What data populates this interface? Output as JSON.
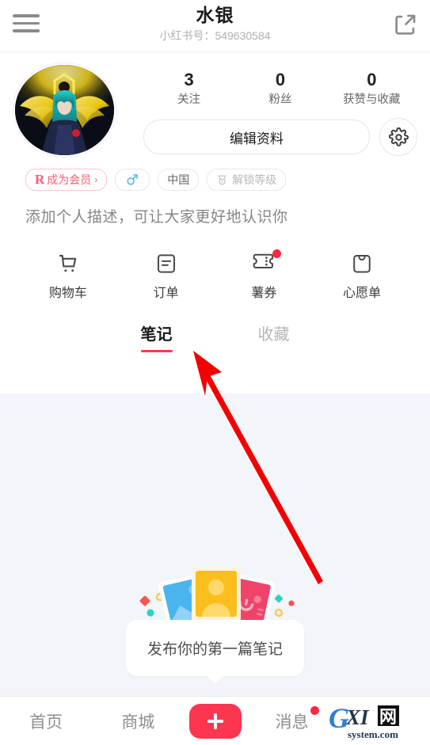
{
  "header": {
    "title": "水银",
    "subtitle": "小红书号：549630584",
    "menu_icon": "hamburger-icon",
    "share_icon": "share-icon"
  },
  "profile": {
    "avatar_alt": "anime-winged-character-avatar",
    "stats": [
      {
        "value": "3",
        "label": "关注"
      },
      {
        "value": "0",
        "label": "粉丝"
      },
      {
        "value": "0",
        "label": "获赞与收藏"
      }
    ],
    "edit_label": "编辑资料",
    "settings_icon": "gear-icon",
    "bio_placeholder": "添加个人描述，可让大家更好地认识你",
    "tags": [
      {
        "id": "member",
        "prefix": "R",
        "label": "成为会员",
        "chevron": "›"
      },
      {
        "id": "gender",
        "label": "♂"
      },
      {
        "id": "region",
        "label": "中国"
      },
      {
        "id": "level",
        "label": "解锁等级"
      }
    ]
  },
  "quick_actions": [
    {
      "label": "购物车",
      "icon": "cart-icon",
      "badge": false
    },
    {
      "label": "订单",
      "icon": "order-document-icon",
      "badge": false
    },
    {
      "label": "薯券",
      "icon": "coupon-ticket-icon",
      "badge": true
    },
    {
      "label": "心愿单",
      "icon": "wishlist-bag-icon",
      "badge": false
    }
  ],
  "tabs": [
    {
      "label": "笔记",
      "active": true
    },
    {
      "label": "收藏",
      "active": false
    }
  ],
  "empty_state": {
    "message": "发布你的第一篇笔记",
    "illustration": "three-photo-cards-illustration"
  },
  "bottom_nav": {
    "items": [
      {
        "label": "首页",
        "badge": false
      },
      {
        "label": "商城",
        "badge": false
      },
      {
        "label": "消息",
        "badge": true
      }
    ],
    "create_icon": "plus-icon"
  },
  "watermark": {
    "main": "GXI网",
    "sub": "system.com"
  },
  "colors": {
    "accent_red": "#fc3550",
    "tab_underline": "#ff3a4e",
    "member_pink": "#fb5a6e",
    "gender_blue": "#4db8f5",
    "content_bg": "#f2f5f9",
    "badge_red": "#ff2741",
    "arrow_red": "#f40000"
  }
}
